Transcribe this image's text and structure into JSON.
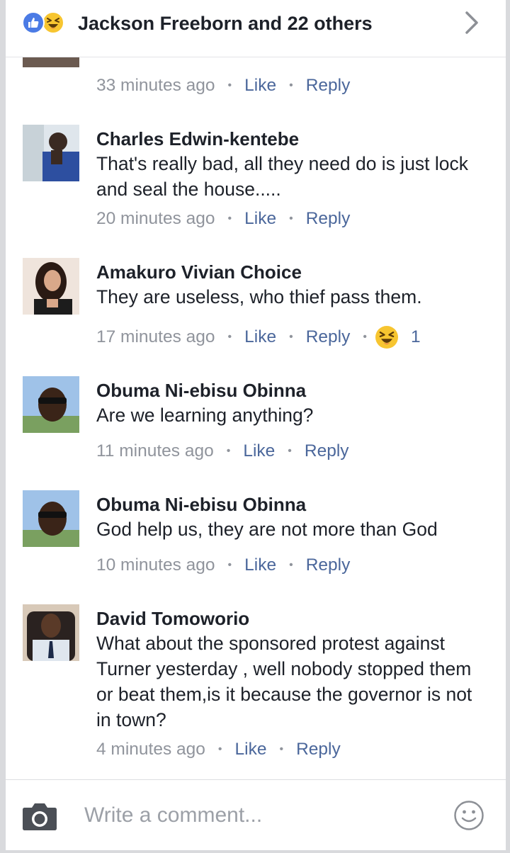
{
  "header": {
    "title": "Jackson Freeborn and 22 others"
  },
  "colors": {
    "like_blue": "#4b7be5",
    "link": "#4b679b",
    "meta_gray": "#90949c",
    "haha_yellow": "#f7c530"
  },
  "comments": [
    {
      "author": "",
      "text": "",
      "time": "33 minutes ago",
      "like": "Like",
      "reply": "Reply"
    },
    {
      "author": "Charles Edwin-kentebe",
      "text": "That's really bad, all they need do is just lock and seal the house.....",
      "time": "20 minutes ago",
      "like": "Like",
      "reply": "Reply"
    },
    {
      "author": "Amakuro Vivian Choice",
      "text": "They are useless, who thief pass them.",
      "time": "17 minutes ago",
      "like": "Like",
      "reply": "Reply",
      "reaction_icon": "haha-icon",
      "reaction_count": "1"
    },
    {
      "author": "Obuma Ni-ebisu Obinna",
      "text": "Are we learning anything?",
      "time": "11 minutes ago",
      "like": "Like",
      "reply": "Reply"
    },
    {
      "author": "Obuma Ni-ebisu Obinna",
      "text": "God help us, they are not more than God",
      "time": "10 minutes ago",
      "like": "Like",
      "reply": "Reply"
    },
    {
      "author": "David Tomoworio",
      "text": "What about the sponsored protest against Turner yesterday , well nobody stopped them or beat them,is it because the governor is not in town?",
      "time": "4 minutes ago",
      "like": "Like",
      "reply": "Reply"
    }
  ],
  "composer": {
    "placeholder": "Write a comment..."
  }
}
